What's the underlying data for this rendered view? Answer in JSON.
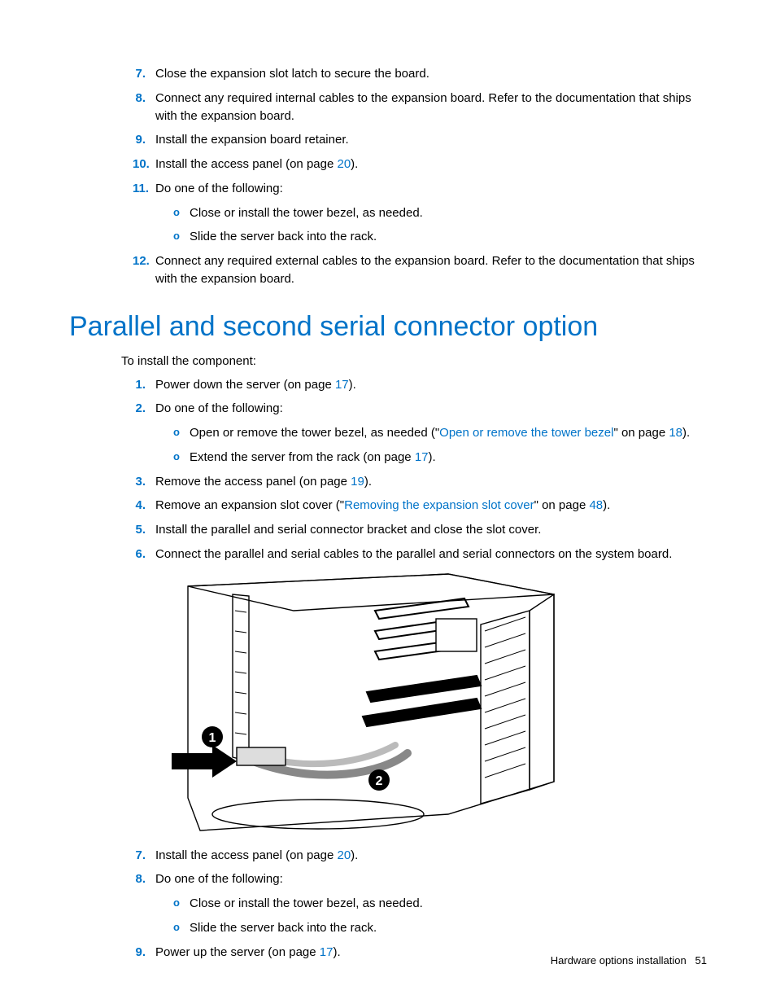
{
  "top_list": [
    {
      "n": "7.",
      "text": "Close the expansion slot latch to secure the board."
    },
    {
      "n": "8.",
      "text": "Connect any required internal cables to the expansion board. Refer to the documentation that ships with the expansion board."
    },
    {
      "n": "9.",
      "text": "Install the expansion board retainer."
    },
    {
      "n": "10.",
      "text_before": "Install the access panel (on page ",
      "link": "20",
      "text_after": ")."
    },
    {
      "n": "11.",
      "text": "Do one of the following:",
      "subs": [
        "Close or install the tower bezel, as needed.",
        "Slide the server back into the rack."
      ]
    },
    {
      "n": "12.",
      "text": "Connect any required external cables to the expansion board. Refer to the documentation that ships with the expansion board."
    }
  ],
  "heading": "Parallel and second serial connector option",
  "intro": "To install the component:",
  "main_list": [
    {
      "n": "1.",
      "text_before": "Power down the server (on page ",
      "link": "17",
      "text_after": ")."
    },
    {
      "n": "2.",
      "text": "Do one of the following:",
      "subs_complex": [
        {
          "before": "Open or remove the tower bezel, as needed (\"",
          "link1": "Open or remove the tower bezel",
          "mid": "\" on page ",
          "link2": "18",
          "after": ")."
        },
        {
          "before": "Extend the server from the rack (on page ",
          "link1": "17",
          "after": ")."
        }
      ]
    },
    {
      "n": "3.",
      "text_before": "Remove the access panel (on page ",
      "link": "19",
      "text_after": ")."
    },
    {
      "n": "4.",
      "text_before": "Remove an expansion slot cover (\"",
      "link": "Removing the expansion slot cover",
      "mid": "\" on page ",
      "link2": "48",
      "text_after": ")."
    },
    {
      "n": "5.",
      "text": "Install the parallel and serial connector bracket and close the slot cover."
    },
    {
      "n": "6.",
      "text": "Connect the parallel and serial cables to the parallel and serial connectors on the system board."
    }
  ],
  "after_figure": [
    {
      "n": "7.",
      "text_before": "Install the access panel (on page ",
      "link": "20",
      "text_after": ")."
    },
    {
      "n": "8.",
      "text": "Do one of the following:",
      "subs": [
        "Close or install the tower bezel, as needed.",
        "Slide the server back into the rack."
      ]
    },
    {
      "n": "9.",
      "text_before": "Power up the server (on page ",
      "link": "17",
      "text_after": ")."
    }
  ],
  "footer_text": "Hardware options installation",
  "footer_page": "51",
  "bullet_char": "o",
  "callout1": "1",
  "callout2": "2"
}
